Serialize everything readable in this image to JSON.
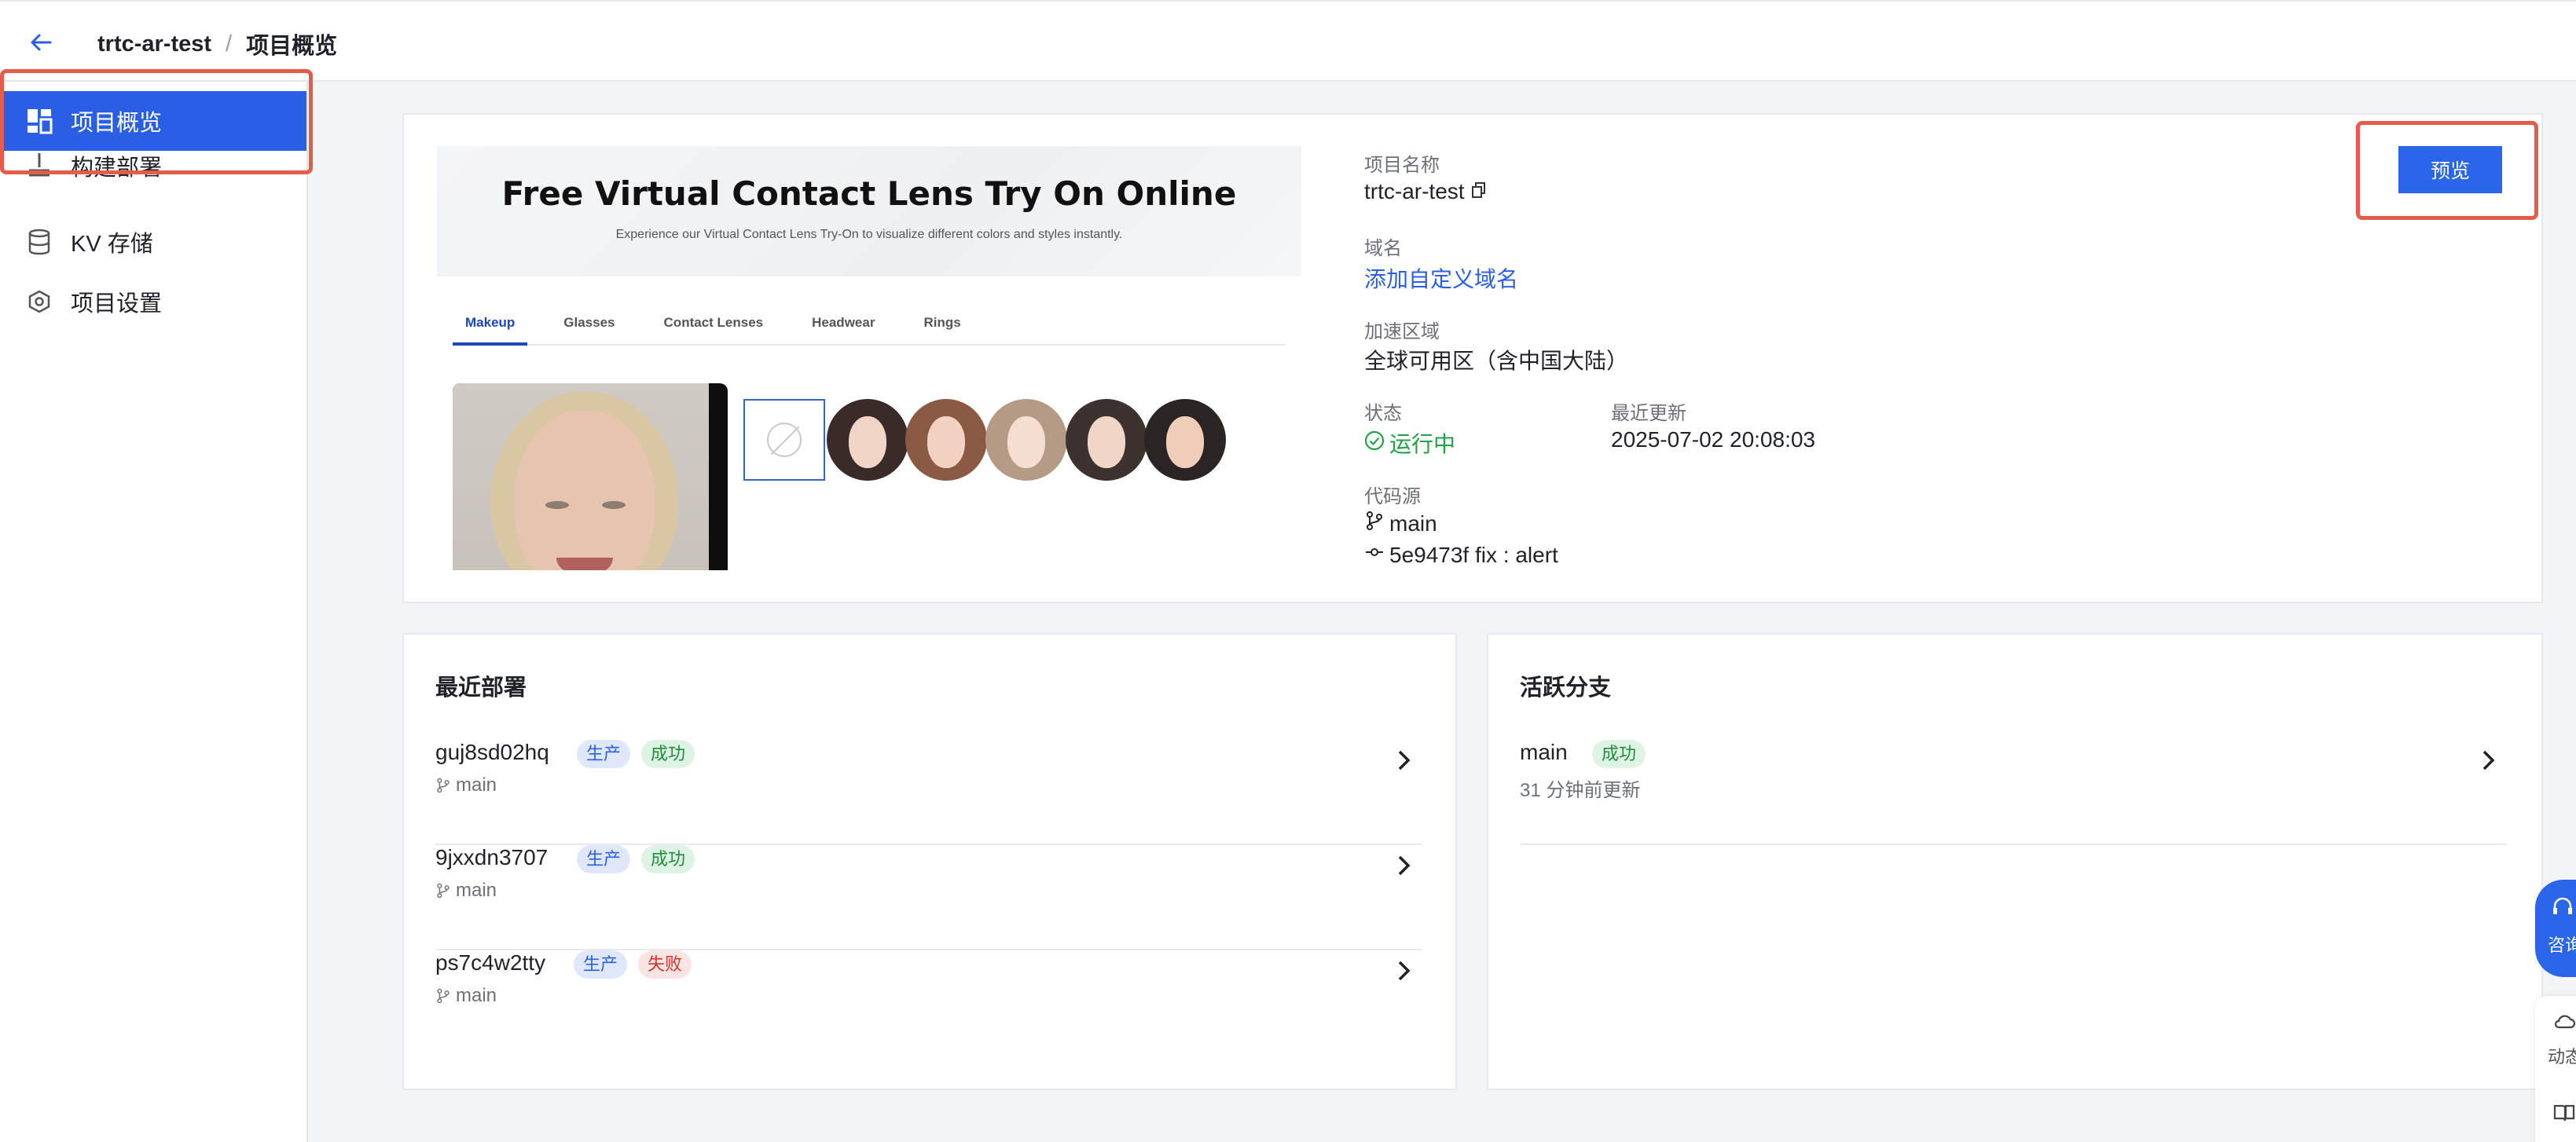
{
  "header": {
    "project": "trtc-ar-test",
    "separator": "/",
    "page": "项目概览"
  },
  "sidebar": {
    "items": [
      {
        "label": "项目概览",
        "icon": "dashboard-icon"
      },
      {
        "label": "构建部署",
        "icon": "build-icon"
      },
      {
        "label": "KV 存储",
        "icon": "database-icon"
      },
      {
        "label": "项目设置",
        "icon": "settings-icon"
      }
    ]
  },
  "preview": {
    "title": "Free Virtual Contact Lens Try On Online",
    "subtitle": "Experience our Virtual Contact Lens Try-On to visualize different colors and styles instantly.",
    "tabs": [
      "Makeup",
      "Glasses",
      "Contact Lenses",
      "Headwear",
      "Rings"
    ]
  },
  "info": {
    "name_label": "项目名称",
    "name": "trtc-ar-test",
    "domain_label": "域名",
    "domain_link": "添加自定义域名",
    "region_label": "加速区域",
    "region": "全球可用区（含中国大陆）",
    "status_label": "状态",
    "status": "运行中",
    "updated_label": "最近更新",
    "updated": "2025-07-02 20:08:03",
    "source_label": "代码源",
    "branch": "main",
    "commit": "5e9473f fix : alert",
    "preview_button": "预览"
  },
  "deployments": {
    "title": "最近部署",
    "rows": [
      {
        "id": "guj8sd02hq",
        "env": "生产",
        "status": "成功",
        "branch": "main"
      },
      {
        "id": "9jxxdn3707",
        "env": "生产",
        "status": "成功",
        "branch": "main"
      },
      {
        "id": "ps7c4w2tty",
        "env": "生产",
        "status": "失败",
        "branch": "main"
      }
    ]
  },
  "branches": {
    "title": "活跃分支",
    "rows": [
      {
        "name": "main",
        "status": "成功",
        "updated": "31 分钟前更新"
      }
    ]
  },
  "floating": {
    "consult": "咨询",
    "news": "动态"
  },
  "colors": {
    "primary": "#2b65e8",
    "highlight": "#e35d4a",
    "success": "#24a148"
  }
}
